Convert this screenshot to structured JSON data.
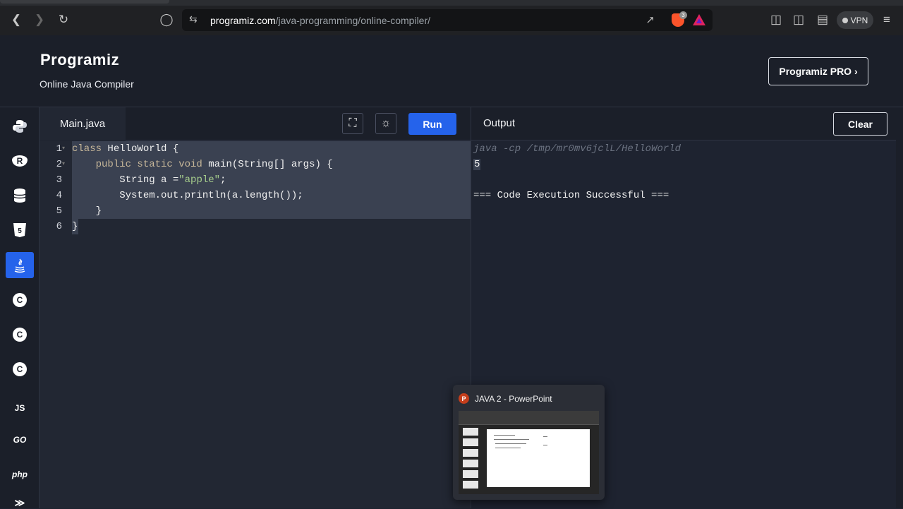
{
  "browser": {
    "url_domain": "programiz.com",
    "url_path": "/java-programming/online-compiler/",
    "brave_badge": "3",
    "vpn_label": "VPN"
  },
  "header": {
    "logo": "Programiz",
    "subtitle": "Online Java Compiler",
    "pro_button": "Programiz PRO ›"
  },
  "sidebar": {
    "languages": [
      {
        "name": "python",
        "label": ""
      },
      {
        "name": "r",
        "label": "R"
      },
      {
        "name": "sql",
        "label": ""
      },
      {
        "name": "html",
        "label": "5"
      },
      {
        "name": "java",
        "label": "",
        "active": true
      },
      {
        "name": "c",
        "label": "C"
      },
      {
        "name": "cpp",
        "label": "C"
      },
      {
        "name": "csharp",
        "label": "C"
      },
      {
        "name": "js",
        "label": "JS"
      },
      {
        "name": "go",
        "label": "GO"
      },
      {
        "name": "php",
        "label": "php"
      }
    ]
  },
  "editor": {
    "file_tab": "Main.java",
    "run_button": "Run",
    "lines": [
      {
        "n": "1",
        "pre": "",
        "kw": "class",
        "rest": " HelloWorld {"
      },
      {
        "n": "2",
        "pre": "    ",
        "kw": "public static void",
        "rest": " main(String[] args) {"
      },
      {
        "n": "3",
        "pre": "        String a =",
        "str": "\"apple\"",
        "rest": ";"
      },
      {
        "n": "4",
        "pre": "        System.out.println(a.length());",
        "rest": ""
      },
      {
        "n": "5",
        "pre": "    }",
        "rest": ""
      },
      {
        "n": "6",
        "pre": "}",
        "rest": ""
      }
    ]
  },
  "output": {
    "title": "Output",
    "clear_button": "Clear",
    "command": "java -cp /tmp/mr0mv6jclL/HelloWorld",
    "result": "5",
    "message": "=== Code Execution Successful ==="
  },
  "taskbar_preview": {
    "app_icon": "P",
    "title": "JAVA 2 - PowerPoint"
  }
}
